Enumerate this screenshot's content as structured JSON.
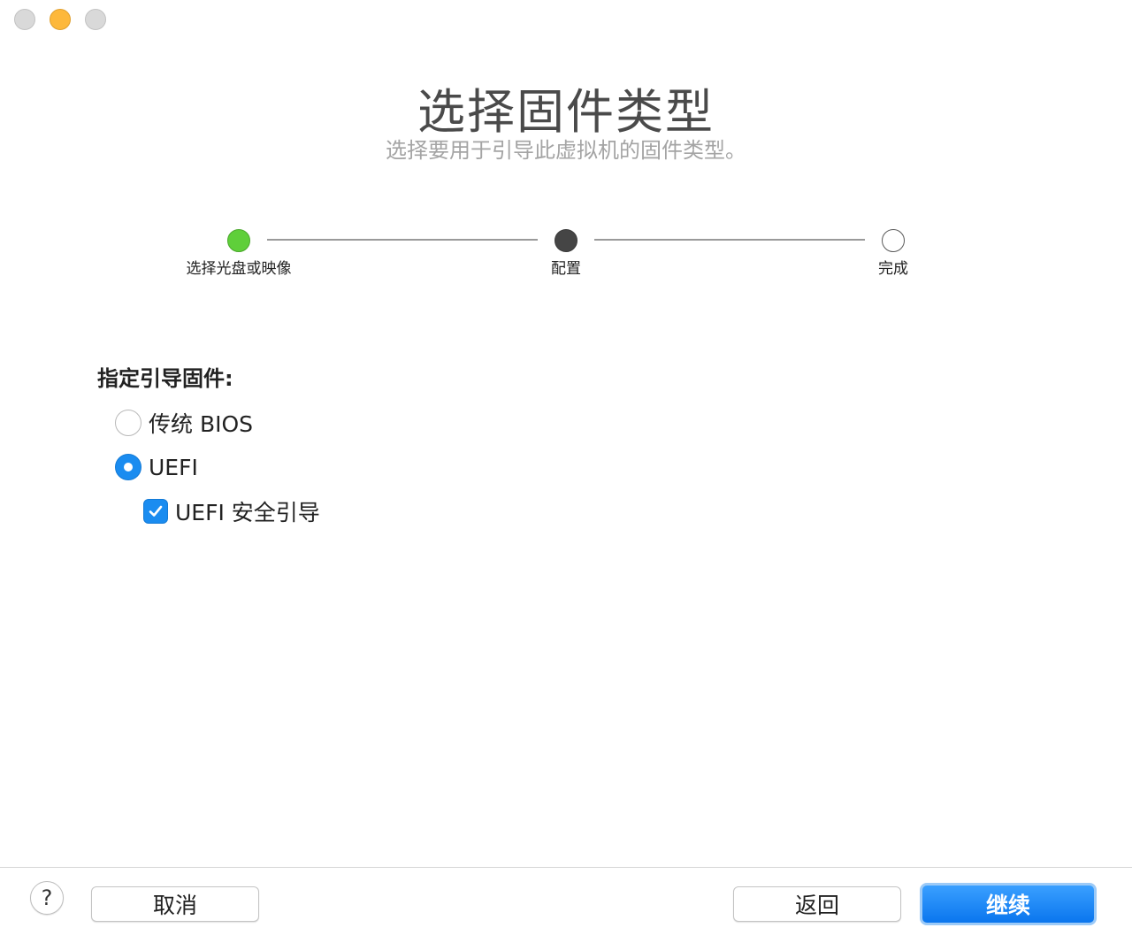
{
  "window": {
    "title": "选择固件类型",
    "subtitle": "选择要用于引导此虚拟机的固件类型。"
  },
  "steps": [
    {
      "label": "选择光盘或映像",
      "status": "done"
    },
    {
      "label": "配置",
      "status": "current"
    },
    {
      "label": "完成",
      "status": "todo"
    }
  ],
  "firmware": {
    "section_label": "指定引导固件:",
    "options": [
      {
        "label": "传统 BIOS",
        "selected": false
      },
      {
        "label": "UEFI",
        "selected": true
      }
    ],
    "secure_boot": {
      "label": "UEFI 安全引导",
      "checked": true
    }
  },
  "footer": {
    "help": "?",
    "cancel": "取消",
    "back": "返回",
    "continue": "继续"
  },
  "colors": {
    "accent": "#1a8cf0",
    "step_done": "#5fcf3a",
    "step_current": "#454545"
  }
}
